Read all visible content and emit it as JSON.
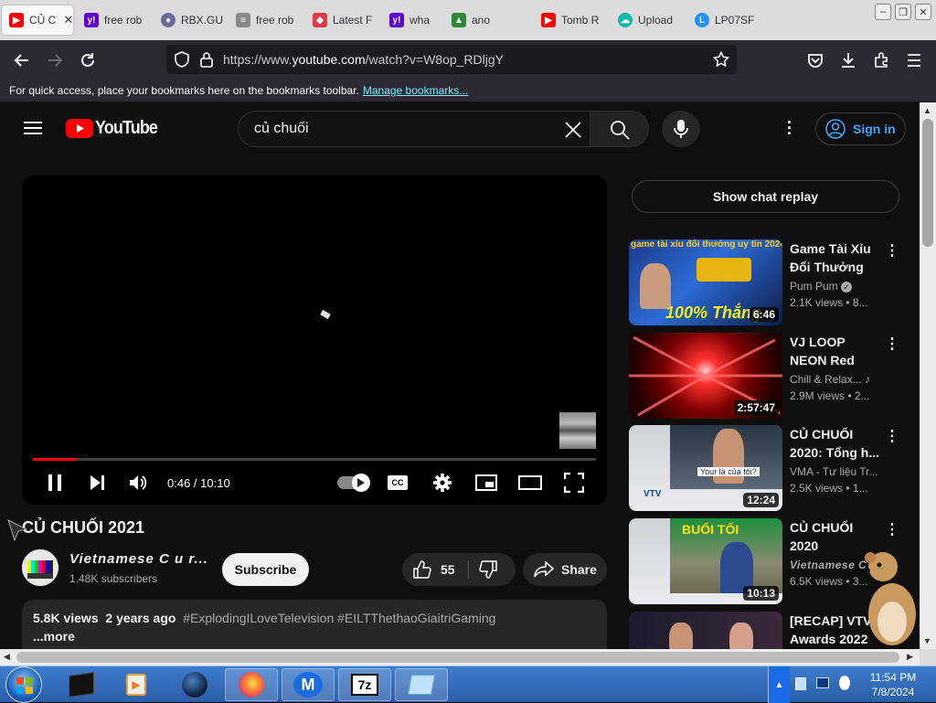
{
  "browser": {
    "tabs": [
      {
        "label": "CỦ C",
        "icon": "youtube-icon",
        "color": "#ff0000",
        "active": true
      },
      {
        "label": "free rob",
        "icon": "yahoo-icon",
        "color": "#6001d2"
      },
      {
        "label": "RBX.GU",
        "icon": "globe-icon",
        "color": "#6b6b9a"
      },
      {
        "label": "free rob",
        "icon": "search-results-icon",
        "color": "#888888"
      },
      {
        "label": "Latest F",
        "icon": "tag-icon",
        "color": "#e03a4a"
      },
      {
        "label": "wha",
        "icon": "yahoo-icon",
        "color": "#6001d2"
      },
      {
        "label": "ano",
        "icon": "alien-icon",
        "color": "#2d8a3a"
      },
      {
        "label": "Tomb R",
        "icon": "youtube-icon",
        "color": "#ff0000"
      },
      {
        "label": "Upload",
        "icon": "upload-cloud-icon",
        "color": "#14b8a6"
      },
      {
        "label": "LP07SF",
        "icon": "lp-icon",
        "color": "#1e90ff"
      }
    ],
    "url_prefix": "https://www.",
    "url_domain": "youtube.com",
    "url_suffix": "/watch?v=W8op_RDljgY",
    "bookmarks_text": "For quick access, place your bookmarks here on the bookmarks toolbar.",
    "bookmarks_link": "Manage bookmarks..."
  },
  "youtube": {
    "logo_text": "YouTube",
    "search_value": "củ chuối",
    "signin_label": "Sign in",
    "player": {
      "time_current": "0:46",
      "time_total": "10:10",
      "time_separator": " / ",
      "progress_fraction": 0.076
    },
    "video": {
      "title": "CỦ CHUỐI 2021",
      "channel": "Vietnamese C u r...",
      "subscribers": "1.48K subscribers",
      "subscribe_label": "Subscribe",
      "likes": "55",
      "share_label": "Share",
      "views": "5.8K views",
      "age": "2 years ago",
      "hashtags": "#ExplodingILoveTelevision #EILTThethaoGiaitriGaming",
      "more_label": "...more"
    },
    "chat_replay_label": "Show chat replay",
    "recommendations": [
      {
        "title": "Game Tài Xỉu Đổi Thưởng |...",
        "channel": "Pum Pum",
        "meta": "2.1K views • 8...",
        "duration": "6:46",
        "thumb_caption": "game tài xỉu đổi thưởng uy tín 2024",
        "thumb_badge": "100% Thắng",
        "verified": true
      },
      {
        "title": "VJ LOOP NEON Red Metallic...",
        "channel": "Chill & Relax...",
        "meta": "2.9M views • 2...",
        "duration": "2:57:47",
        "music_note": true
      },
      {
        "title": "CỦ CHUỐI 2020: Tổng h...",
        "channel": "VMA - Tư liệu Tr...",
        "meta": "2.5K views • 1...",
        "duration": "12:24",
        "thumb_caption": "Your là của tôi?",
        "thumb_logo": "VTV"
      },
      {
        "title": "CỦ CHUỐI 2020",
        "channel": "Vietnamese C u r...",
        "meta": "6.5K views • 3...",
        "duration": "10:13",
        "thumb_caption": "BUỔI TỐI"
      },
      {
        "title": "[RECAP] VTV Awards 2022",
        "channel": "",
        "meta": "",
        "duration": ""
      }
    ]
  },
  "taskbar": {
    "time": "11:54 PM",
    "date": "7/8/2024",
    "apps": [
      "start-orb-icon",
      "terminal-icon",
      "media-player-icon",
      "globe-dark-icon",
      "firefox-icon",
      "malwarebytes-icon",
      "7zip-icon",
      "notepad-icon"
    ]
  },
  "colors": {
    "yt_bg": "#0f0f0f",
    "yt_red": "#ff0000",
    "link_blue": "#3ea6ff",
    "firefox_toolbar": "#2b2a33"
  }
}
